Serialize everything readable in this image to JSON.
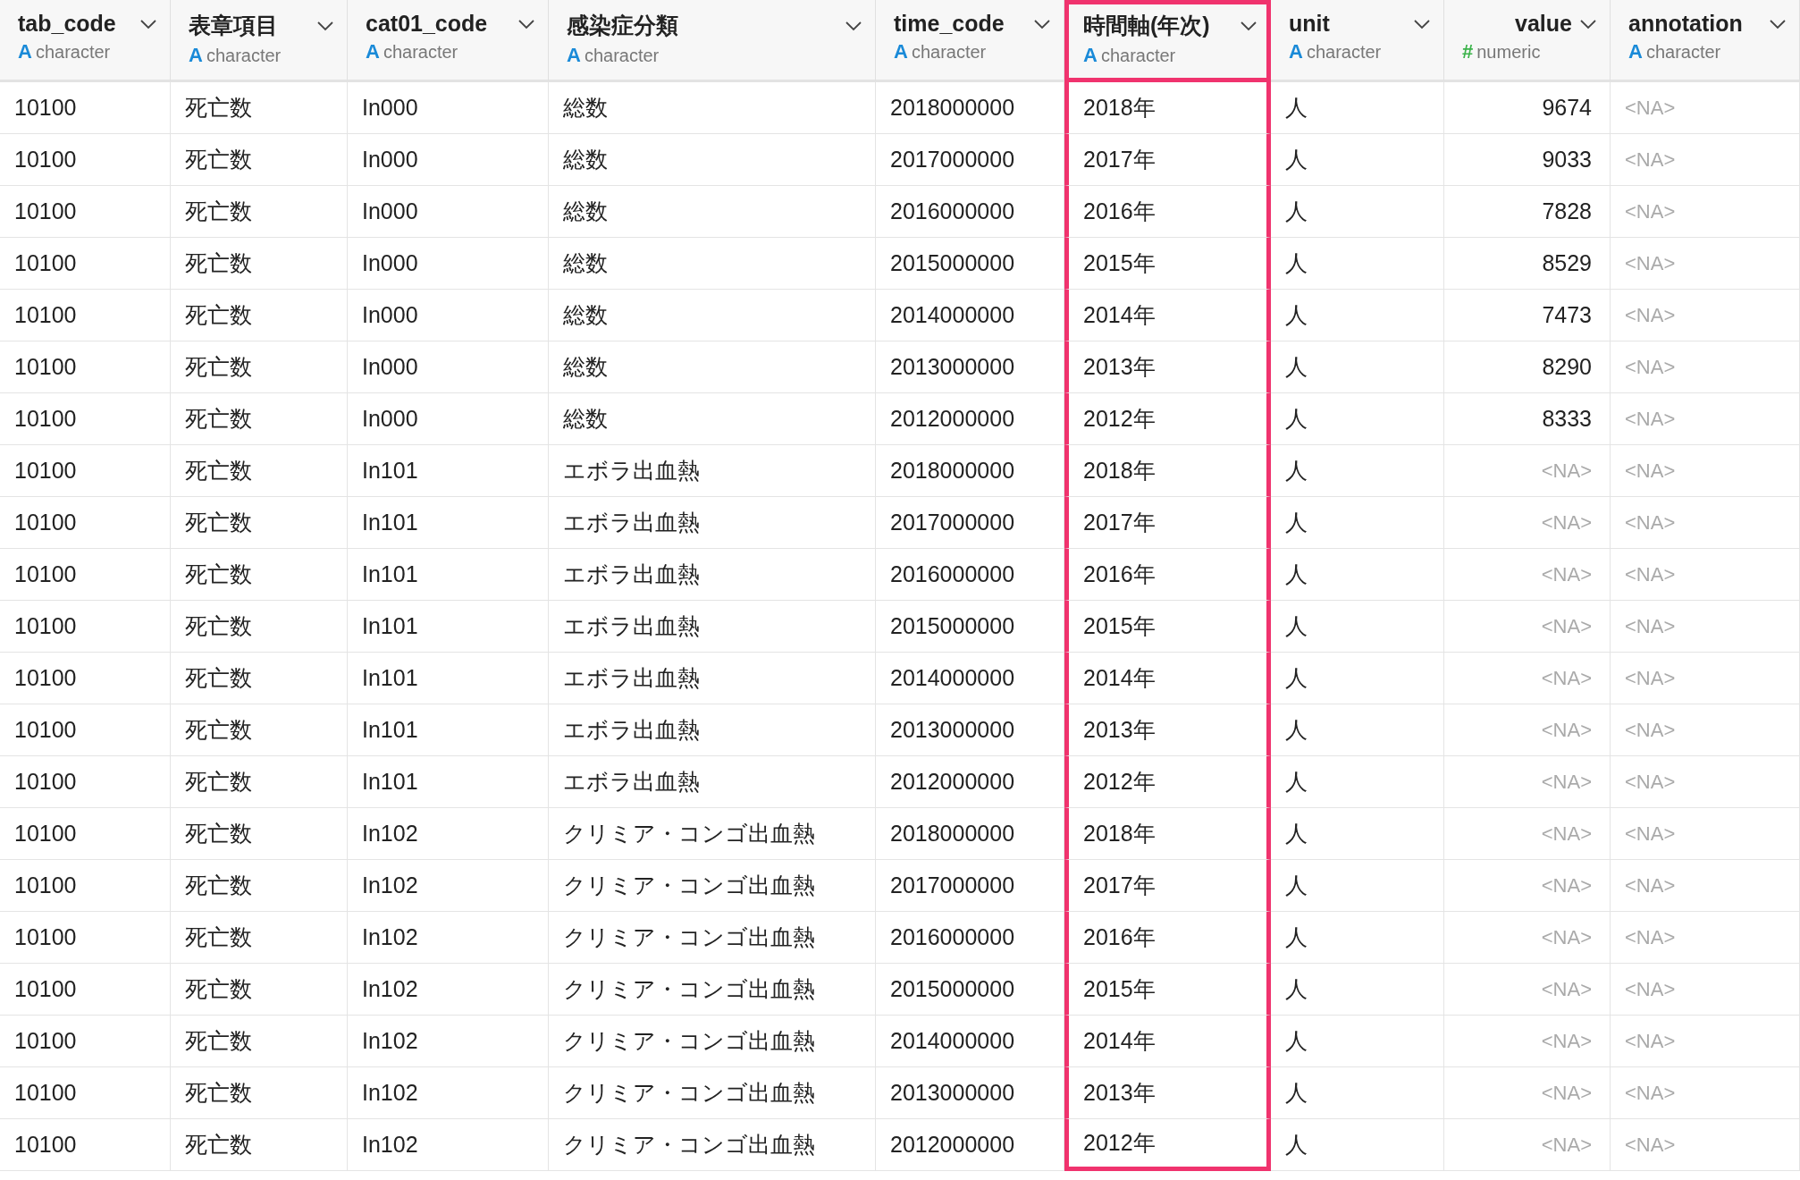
{
  "table": {
    "columns": [
      {
        "name": "tab_code",
        "type_icon": "A",
        "type": "character",
        "kind": "text",
        "selected": false
      },
      {
        "name": "表章項目",
        "type_icon": "A",
        "type": "character",
        "kind": "text",
        "selected": false
      },
      {
        "name": "cat01_code",
        "type_icon": "A",
        "type": "character",
        "kind": "text",
        "selected": false
      },
      {
        "name": "感染症分類",
        "type_icon": "A",
        "type": "character",
        "kind": "text",
        "selected": false
      },
      {
        "name": "time_code",
        "type_icon": "A",
        "type": "character",
        "kind": "text",
        "selected": false
      },
      {
        "name": "時間軸(年次)",
        "type_icon": "A",
        "type": "character",
        "kind": "text",
        "selected": true
      },
      {
        "name": "unit",
        "type_icon": "A",
        "type": "character",
        "kind": "text",
        "selected": false
      },
      {
        "name": "value",
        "type_icon": "#",
        "type": "numeric",
        "kind": "number",
        "selected": false
      },
      {
        "name": "annotation",
        "type_icon": "A",
        "type": "character",
        "kind": "text",
        "selected": false
      }
    ],
    "rows": [
      {
        "cells": [
          "10100",
          "死亡数",
          "In000",
          "総数",
          "2018000000",
          "2018年",
          "人",
          {
            "text": "9674",
            "missing": false
          },
          {
            "text": "<NA>",
            "missing": true
          }
        ]
      },
      {
        "cells": [
          "10100",
          "死亡数",
          "In000",
          "総数",
          "2017000000",
          "2017年",
          "人",
          {
            "text": "9033",
            "missing": false
          },
          {
            "text": "<NA>",
            "missing": true
          }
        ]
      },
      {
        "cells": [
          "10100",
          "死亡数",
          "In000",
          "総数",
          "2016000000",
          "2016年",
          "人",
          {
            "text": "7828",
            "missing": false
          },
          {
            "text": "<NA>",
            "missing": true
          }
        ]
      },
      {
        "cells": [
          "10100",
          "死亡数",
          "In000",
          "総数",
          "2015000000",
          "2015年",
          "人",
          {
            "text": "8529",
            "missing": false
          },
          {
            "text": "<NA>",
            "missing": true
          }
        ]
      },
      {
        "cells": [
          "10100",
          "死亡数",
          "In000",
          "総数",
          "2014000000",
          "2014年",
          "人",
          {
            "text": "7473",
            "missing": false
          },
          {
            "text": "<NA>",
            "missing": true
          }
        ]
      },
      {
        "cells": [
          "10100",
          "死亡数",
          "In000",
          "総数",
          "2013000000",
          "2013年",
          "人",
          {
            "text": "8290",
            "missing": false
          },
          {
            "text": "<NA>",
            "missing": true
          }
        ]
      },
      {
        "cells": [
          "10100",
          "死亡数",
          "In000",
          "総数",
          "2012000000",
          "2012年",
          "人",
          {
            "text": "8333",
            "missing": false
          },
          {
            "text": "<NA>",
            "missing": true
          }
        ]
      },
      {
        "cells": [
          "10100",
          "死亡数",
          "In101",
          "エボラ出血熱",
          "2018000000",
          "2018年",
          "人",
          {
            "text": "<NA>",
            "missing": true
          },
          {
            "text": "<NA>",
            "missing": true
          }
        ]
      },
      {
        "cells": [
          "10100",
          "死亡数",
          "In101",
          "エボラ出血熱",
          "2017000000",
          "2017年",
          "人",
          {
            "text": "<NA>",
            "missing": true
          },
          {
            "text": "<NA>",
            "missing": true
          }
        ]
      },
      {
        "cells": [
          "10100",
          "死亡数",
          "In101",
          "エボラ出血熱",
          "2016000000",
          "2016年",
          "人",
          {
            "text": "<NA>",
            "missing": true
          },
          {
            "text": "<NA>",
            "missing": true
          }
        ]
      },
      {
        "cells": [
          "10100",
          "死亡数",
          "In101",
          "エボラ出血熱",
          "2015000000",
          "2015年",
          "人",
          {
            "text": "<NA>",
            "missing": true
          },
          {
            "text": "<NA>",
            "missing": true
          }
        ]
      },
      {
        "cells": [
          "10100",
          "死亡数",
          "In101",
          "エボラ出血熱",
          "2014000000",
          "2014年",
          "人",
          {
            "text": "<NA>",
            "missing": true
          },
          {
            "text": "<NA>",
            "missing": true
          }
        ]
      },
      {
        "cells": [
          "10100",
          "死亡数",
          "In101",
          "エボラ出血熱",
          "2013000000",
          "2013年",
          "人",
          {
            "text": "<NA>",
            "missing": true
          },
          {
            "text": "<NA>",
            "missing": true
          }
        ]
      },
      {
        "cells": [
          "10100",
          "死亡数",
          "In101",
          "エボラ出血熱",
          "2012000000",
          "2012年",
          "人",
          {
            "text": "<NA>",
            "missing": true
          },
          {
            "text": "<NA>",
            "missing": true
          }
        ]
      },
      {
        "cells": [
          "10100",
          "死亡数",
          "In102",
          "クリミア・コンゴ出血熱",
          "2018000000",
          "2018年",
          "人",
          {
            "text": "<NA>",
            "missing": true
          },
          {
            "text": "<NA>",
            "missing": true
          }
        ]
      },
      {
        "cells": [
          "10100",
          "死亡数",
          "In102",
          "クリミア・コンゴ出血熱",
          "2017000000",
          "2017年",
          "人",
          {
            "text": "<NA>",
            "missing": true
          },
          {
            "text": "<NA>",
            "missing": true
          }
        ]
      },
      {
        "cells": [
          "10100",
          "死亡数",
          "In102",
          "クリミア・コンゴ出血熱",
          "2016000000",
          "2016年",
          "人",
          {
            "text": "<NA>",
            "missing": true
          },
          {
            "text": "<NA>",
            "missing": true
          }
        ]
      },
      {
        "cells": [
          "10100",
          "死亡数",
          "In102",
          "クリミア・コンゴ出血熱",
          "2015000000",
          "2015年",
          "人",
          {
            "text": "<NA>",
            "missing": true
          },
          {
            "text": "<NA>",
            "missing": true
          }
        ]
      },
      {
        "cells": [
          "10100",
          "死亡数",
          "In102",
          "クリミア・コンゴ出血熱",
          "2014000000",
          "2014年",
          "人",
          {
            "text": "<NA>",
            "missing": true
          },
          {
            "text": "<NA>",
            "missing": true
          }
        ]
      },
      {
        "cells": [
          "10100",
          "死亡数",
          "In102",
          "クリミア・コンゴ出血熱",
          "2013000000",
          "2013年",
          "人",
          {
            "text": "<NA>",
            "missing": true
          },
          {
            "text": "<NA>",
            "missing": true
          }
        ]
      },
      {
        "cells": [
          "10100",
          "死亡数",
          "In102",
          "クリミア・コンゴ出血熱",
          "2012000000",
          "2012年",
          "人",
          {
            "text": "<NA>",
            "missing": true
          },
          {
            "text": "<NA>",
            "missing": true
          }
        ]
      }
    ]
  }
}
